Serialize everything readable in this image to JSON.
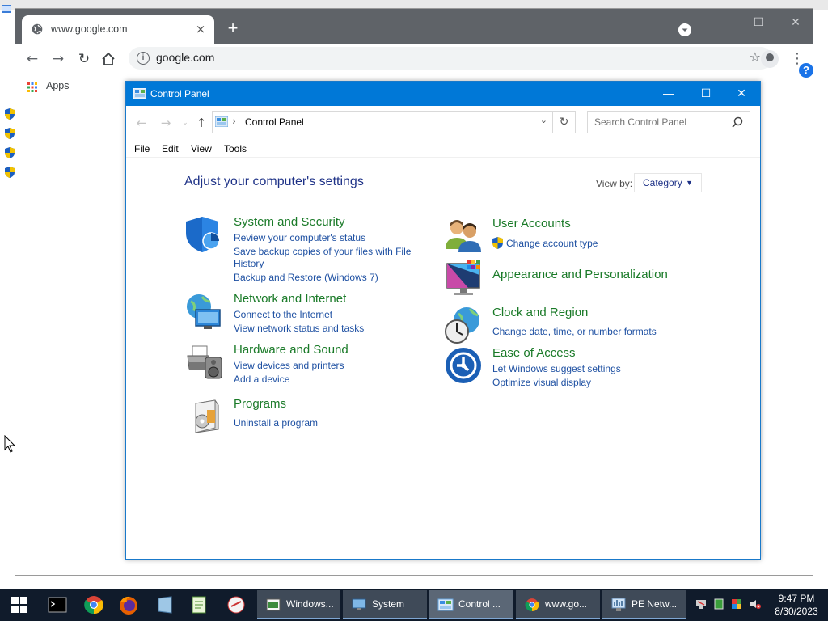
{
  "chrome": {
    "tab_title": "www.google.com",
    "tab_close": "×",
    "new_tab": "+",
    "url": "google.com",
    "info": "i",
    "star": "☆",
    "kebab": "⋮",
    "bookmarks_apps": "Apps",
    "window_minimize": "—",
    "window_maximize": "☐",
    "window_close": "✕",
    "help_badge": "?"
  },
  "control_panel": {
    "window_title": "Control Panel",
    "title_minimize": "—",
    "title_maximize": "☐",
    "title_close": "✕",
    "breadcrumb": "Control Panel",
    "breadcrumb_separator": "›",
    "search_placeholder": "Search Control Panel",
    "menu": [
      "File",
      "Edit",
      "View",
      "Tools"
    ],
    "heading": "Adjust your computer's settings",
    "view_by_label": "View by:",
    "view_by_value": "Category",
    "categories": [
      {
        "title": "System and Security",
        "links": [
          "Review your computer's status",
          "Save backup copies of your files with File",
          "History",
          "Backup and Restore (Windows 7)"
        ],
        "icon": "shield-icon"
      },
      {
        "title": "Network and Internet",
        "links": [
          "Connect to the Internet",
          "View network status and tasks"
        ],
        "icon": "network-globe-icon"
      },
      {
        "title": "Hardware and Sound",
        "links": [
          "View devices and printers",
          "Add a device"
        ],
        "icon": "printer-icon"
      },
      {
        "title": "Programs",
        "links": [
          "Uninstall a program"
        ],
        "icon": "programs-box-icon"
      },
      {
        "title": "User Accounts",
        "links": [
          "Change account type"
        ],
        "icon": "users-icon"
      },
      {
        "title": "Appearance and Personalization",
        "links": [],
        "icon": "monitor-palette-icon"
      },
      {
        "title": "Clock and Region",
        "links": [
          "Change date, time, or number formats"
        ],
        "icon": "clock-globe-icon"
      },
      {
        "title": "Ease of Access",
        "links": [
          "Let Windows suggest settings",
          "Optimize visual display"
        ],
        "icon": "ease-of-access-icon"
      }
    ]
  },
  "taskbar": {
    "buttons": [
      {
        "label": "Windows...",
        "icon": "explorer-icon"
      },
      {
        "label": "System",
        "icon": "system-icon"
      },
      {
        "label": "Control ...",
        "icon": "control-panel-icon"
      },
      {
        "label": "www.go...",
        "icon": "chrome-icon"
      },
      {
        "label": "PE Netw...",
        "icon": "network-icon"
      }
    ],
    "time": "9:47 PM",
    "date": "8/30/2023"
  },
  "colors": {
    "titlebar": "#0078d7",
    "link": "#1e50a2",
    "category_title": "#1a7a28",
    "heading": "#1e3287",
    "taskbar": "#101b2b"
  }
}
